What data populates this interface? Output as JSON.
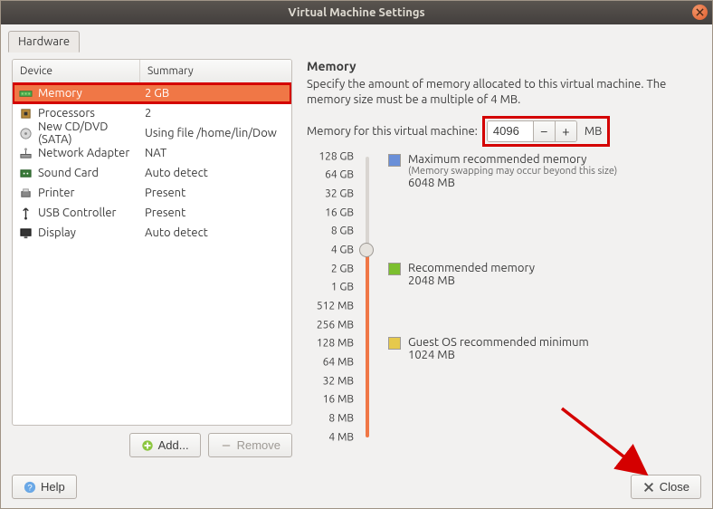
{
  "window": {
    "title": "Virtual Machine Settings"
  },
  "tab": {
    "hardware": "Hardware"
  },
  "table": {
    "col_device": "Device",
    "col_summary": "Summary"
  },
  "devices": [
    {
      "icon": "memory",
      "name": "Memory",
      "summary": "2 GB",
      "selected": true,
      "highlight": true
    },
    {
      "icon": "cpu",
      "name": "Processors",
      "summary": "2"
    },
    {
      "icon": "disc",
      "name": "New CD/DVD (SATA)",
      "summary": "Using file /home/lin/Dow"
    },
    {
      "icon": "net",
      "name": "Network Adapter",
      "summary": "NAT"
    },
    {
      "icon": "sound",
      "name": "Sound Card",
      "summary": "Auto detect"
    },
    {
      "icon": "printer",
      "name": "Printer",
      "summary": "Present"
    },
    {
      "icon": "usb",
      "name": "USB Controller",
      "summary": "Present"
    },
    {
      "icon": "display",
      "name": "Display",
      "summary": "Auto detect"
    }
  ],
  "buttons": {
    "add": "Add...",
    "remove": "Remove",
    "help": "Help",
    "close": "Close"
  },
  "memory": {
    "heading": "Memory",
    "description": "Specify the amount of memory allocated to this virtual machine. The memory size must be a multiple of 4 MB.",
    "row_label": "Memory for this virtual machine:",
    "value": "4096",
    "unit": "MB",
    "ticks": [
      "128 GB",
      "64 GB",
      "32 GB",
      "16 GB",
      "8 GB",
      "4 GB",
      "2 GB",
      "1 GB",
      "512 MB",
      "256 MB",
      "128 MB",
      "64 MB",
      "32 MB",
      "16 MB",
      "8 MB",
      "4 MB"
    ],
    "markers": {
      "max": {
        "title": "Maximum recommended memory",
        "sub": "(Memory swapping may occur beyond this size)",
        "value": "6048 MB",
        "color": "#6a8fd8"
      },
      "rec": {
        "title": "Recommended memory",
        "value": "2048 MB",
        "color": "#7cbf2f"
      },
      "minos": {
        "title": "Guest OS recommended minimum",
        "value": "1024 MB",
        "color": "#e6c94c"
      }
    }
  }
}
